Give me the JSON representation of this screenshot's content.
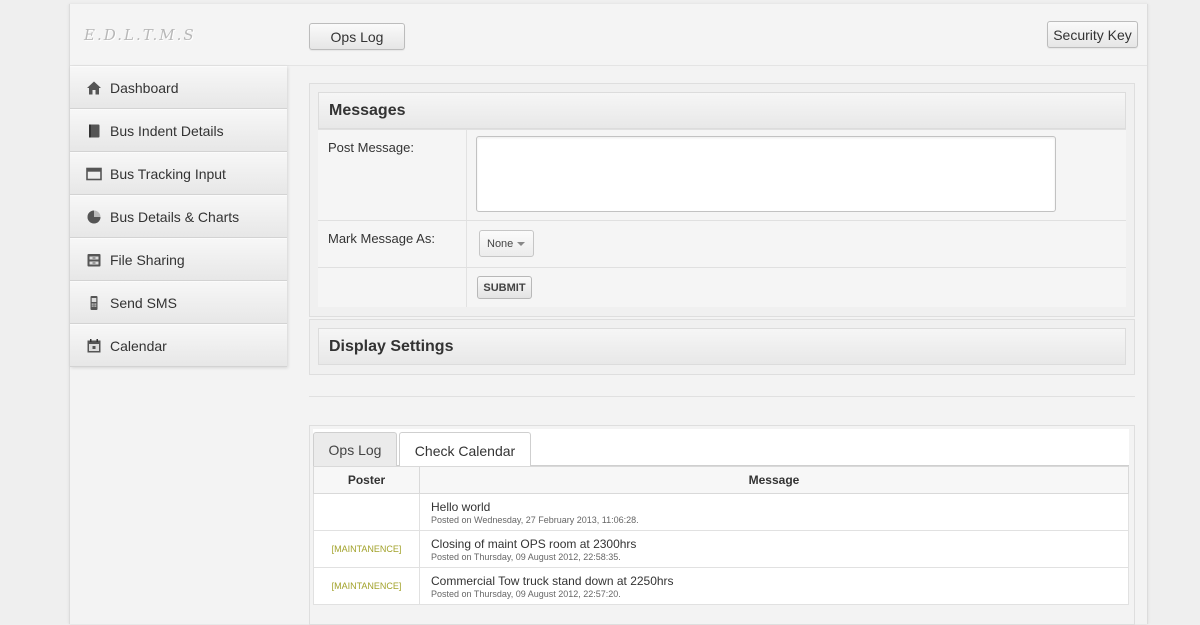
{
  "app": {
    "logo": "E.D.L.T.M.S"
  },
  "header": {
    "ops_log_button": "Ops Log",
    "security_key_button": "Security Key"
  },
  "sidebar": {
    "items": [
      {
        "label": "Dashboard",
        "icon": "home-icon"
      },
      {
        "label": "Bus Indent Details",
        "icon": "book-icon"
      },
      {
        "label": "Bus Tracking Input",
        "icon": "window-icon"
      },
      {
        "label": "Bus Details & Charts",
        "icon": "pie-chart-icon"
      },
      {
        "label": "File Sharing",
        "icon": "cabinet-icon"
      },
      {
        "label": "Send SMS",
        "icon": "phone-icon"
      },
      {
        "label": "Calendar",
        "icon": "calendar-icon"
      }
    ]
  },
  "messages": {
    "title": "Messages",
    "post_label": "Post Message:",
    "post_value": "",
    "mark_label": "Mark Message As:",
    "mark_selected": "None",
    "submit_label": "SUBMIT"
  },
  "display_settings": {
    "title": "Display Settings"
  },
  "log": {
    "tabs": [
      "Ops Log",
      "Check Calendar"
    ],
    "columns": [
      "Poster",
      "Message"
    ],
    "rows": [
      {
        "poster": "",
        "message": "Hello world",
        "posted": "Posted on Wednesday, 27 February 2013, 11:06:28."
      },
      {
        "poster": "[MAINTANENCE]",
        "message": "Closing of maint OPS room at 2300hrs",
        "posted": "Posted on Thursday, 09 August 2012, 22:58:35."
      },
      {
        "poster": "[MAINTANENCE]",
        "message": "Commercial Tow truck stand down at 2250hrs",
        "posted": "Posted on Thursday, 09 August 2012, 22:57:20."
      }
    ]
  },
  "colors": {
    "poster_tag": "#a2a22a",
    "background": "#efefef"
  }
}
